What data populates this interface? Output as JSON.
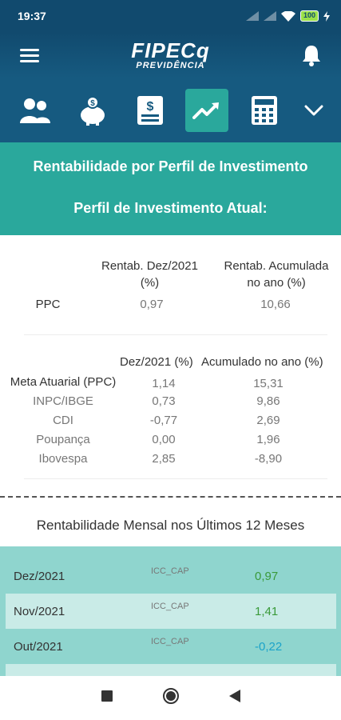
{
  "status_bar": {
    "time": "19:37",
    "battery": "100"
  },
  "header": {
    "logo_main": "FIPECq",
    "logo_sub": "PREVIDÊNCIA"
  },
  "nav": {
    "items": [
      {
        "icon": "users-icon"
      },
      {
        "icon": "piggy-bank-icon"
      },
      {
        "icon": "document-dollar-icon"
      },
      {
        "icon": "trend-chart-icon",
        "active": true
      },
      {
        "icon": "calculator-icon"
      },
      {
        "icon": "chevron-down-icon"
      }
    ]
  },
  "banner": {
    "title": "Rentabilidade por Perfil de Investimento",
    "subtitle": "Perfil de Investimento Atual:"
  },
  "profile": {
    "col1_header_line1": "Rentab. Dez/2021",
    "col1_header_line2": "(%)",
    "col2_header_line1": "Rentab. Acumulada",
    "col2_header_line2": "no ano (%)",
    "row_label": "PPC",
    "row_col1": "0,97",
    "row_col2": "10,66"
  },
  "indices": {
    "col1_header": "Dez/2021 (%)",
    "col2_header": "Acumulado no ano (%)",
    "rows": [
      {
        "label": "Meta Atuarial (PPC)",
        "dez": "1,14",
        "acum": "15,31"
      },
      {
        "label": "INPC/IBGE",
        "dez": "0,73",
        "acum": "9,86"
      },
      {
        "label": "CDI",
        "dez": "-0,77",
        "acum": "2,69"
      },
      {
        "label": "Poupança",
        "dez": "0,00",
        "acum": "1,96"
      },
      {
        "label": "Ibovespa",
        "dez": "2,85",
        "acum": "-8,90"
      }
    ]
  },
  "monthly": {
    "title": "Rentabilidade Mensal nos Últimos 12 Meses",
    "rows": [
      {
        "month": "Dez/2021",
        "plan": "ICC_CAP",
        "value": "0,97",
        "value_color": "#3a9a3a"
      },
      {
        "month": "Nov/2021",
        "plan": "ICC_CAP",
        "value": "1,41",
        "value_color": "#3a9a3a"
      },
      {
        "month": "Out/2021",
        "plan": "ICC_CAP",
        "value": "-0,22",
        "value_color": "#1ba3c9"
      }
    ]
  },
  "colors": {
    "header_dark": "#114a6e",
    "teal": "#2aa89c",
    "row_teal": "#8fd5ce",
    "row_light": "#c9ebe7"
  }
}
